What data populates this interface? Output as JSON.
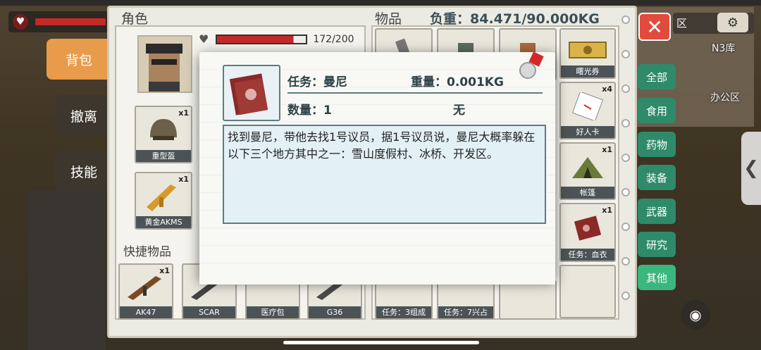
{
  "hud": {
    "health_icon": "heart-monitor-icon"
  },
  "minimap": {
    "zone_label": "区",
    "warehouse_label": "N3库",
    "office_label": "办公区"
  },
  "side_tabs": [
    {
      "label": "背包",
      "active": true
    },
    {
      "label": "撤离",
      "active": false
    },
    {
      "label": "技能",
      "active": false
    }
  ],
  "character": {
    "title": "角色",
    "health_text": "172/200",
    "health_fraction": 0.86,
    "equip": [
      {
        "name": "重型盔",
        "count": "x1"
      },
      {
        "name": "黄金AKMS",
        "count": "x1"
      }
    ],
    "quick_title": "快捷物品",
    "quick_items": [
      {
        "name": "AK47",
        "count": "x1"
      },
      {
        "name": "SCAR",
        "count": ""
      },
      {
        "name": "医疗包",
        "count": ""
      },
      {
        "name": "G36",
        "count": ""
      }
    ]
  },
  "items": {
    "title": "物品",
    "weight_label": "负重：84.471/90.000KG",
    "right_column": [
      {
        "name": "曙光券",
        "count": ""
      },
      {
        "name": "好人卡",
        "count": "x4"
      },
      {
        "name": "帐篷",
        "count": "x1"
      },
      {
        "name": "任务：血衣",
        "count": "x1"
      }
    ],
    "bottom_partial": [
      "任务：3组成",
      "任务：7兴占"
    ]
  },
  "categories": [
    {
      "label": "全部",
      "active": false
    },
    {
      "label": "食用",
      "active": false
    },
    {
      "label": "药物",
      "active": false
    },
    {
      "label": "装备",
      "active": false
    },
    {
      "label": "武器",
      "active": false
    },
    {
      "label": "研究",
      "active": false
    },
    {
      "label": "其他",
      "active": true
    }
  ],
  "popup": {
    "task_label": "任务：曼尼",
    "weight_label": "重量：0.001KG",
    "qty_label": "数量：1",
    "extra_label": "无",
    "description": "找到曼尼，带他去找1号议员，据1号议员说，曼尼大概率躲在以下三个地方其中之一：雪山度假村、冰桥、开发区。"
  },
  "colors": {
    "accent_orange": "#e89b4a",
    "category_green": "#2f8a6a",
    "close_red": "#e14a3c",
    "health_red": "#c62828"
  }
}
